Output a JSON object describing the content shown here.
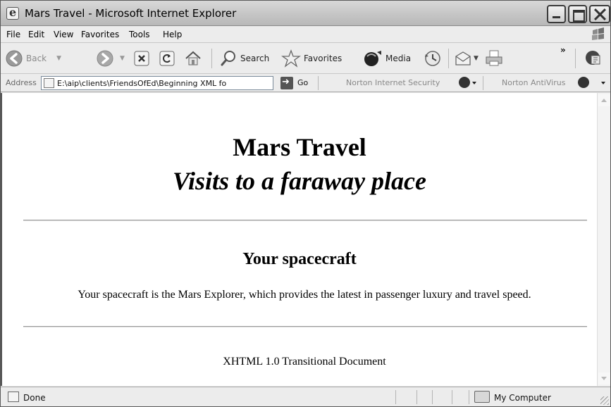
{
  "window": {
    "title": "Mars Travel - Microsoft Internet Explorer"
  },
  "menu": [
    "File",
    "Edit",
    "View",
    "Favorites",
    "Tools",
    "Help"
  ],
  "toolbar": {
    "back_label": "Back",
    "search_label": "Search",
    "favorites_label": "Favorites",
    "media_label": "Media",
    "more_chevron": "»"
  },
  "address": {
    "label": "Address",
    "url": "E:\\aip\\clients\\FriendsOfEd\\Beginning XML fo",
    "go_label": "Go"
  },
  "extensions": {
    "norton_security": "Norton Internet Security",
    "norton_antivirus": "Norton AntiVirus"
  },
  "page": {
    "heading": "Mars Travel",
    "subheading": "Visits to a faraway place",
    "section_heading": "Your spacecraft",
    "paragraph": "Your spacecraft is the Mars Explorer, which provides the latest in passenger luxury and travel speed.",
    "footer": "XHTML 1.0 Transitional Document"
  },
  "status": {
    "text": "Done",
    "zone": "My Computer"
  }
}
